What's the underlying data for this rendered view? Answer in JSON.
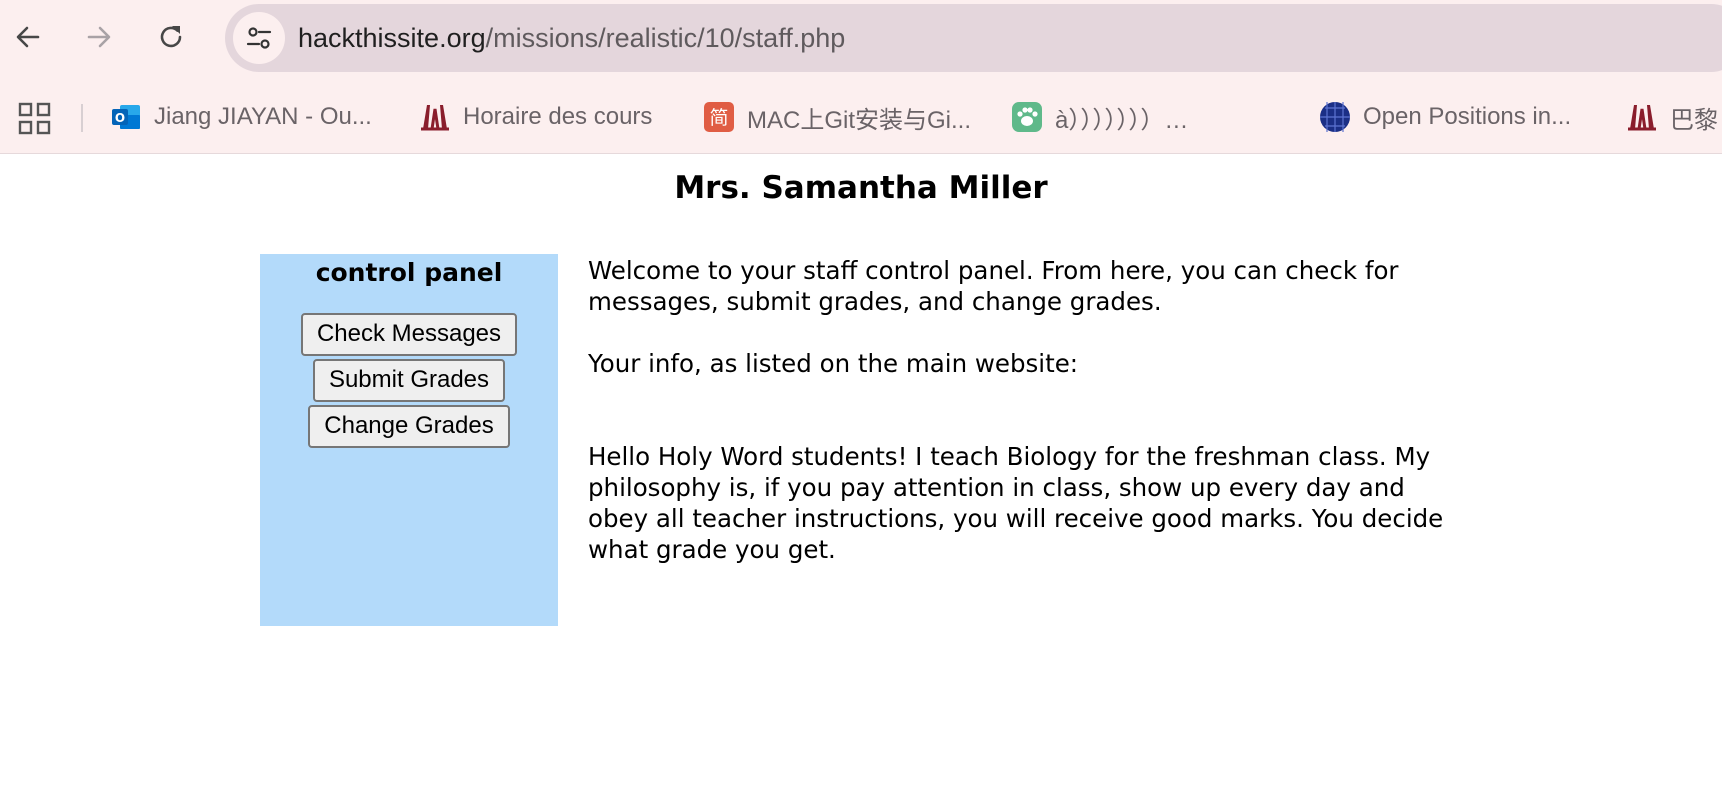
{
  "browser": {
    "url_host": "hackthissite.org",
    "url_path": "/missions/realistic/10/staff.php",
    "bookmarks": [
      {
        "label": "Jiang JIAYAN - Ou...",
        "icon": "outlook-icon"
      },
      {
        "label": "Horaire des cours",
        "icon": "university-logo-icon"
      },
      {
        "label": "MAC上Git安装与Gi...",
        "icon": "jianshu-icon"
      },
      {
        "label": "à）））））））…",
        "icon": "paw-icon"
      },
      {
        "label": "Open Positions in...",
        "icon": "globe-grid-icon"
      },
      {
        "label": "巴黎",
        "icon": "university-logo-icon"
      }
    ]
  },
  "page": {
    "title": "Mrs. Samantha Miller",
    "panel": {
      "heading": "control panel",
      "buttons": {
        "check_messages": "Check Messages",
        "submit_grades": "Submit Grades",
        "change_grades": "Change Grades"
      }
    },
    "welcome": "Welcome to your staff control panel. From here, you can check for messages, submit grades, and change grades.",
    "info_label": "Your info, as listed on the main website:",
    "bio": "Hello Holy Word students! I teach Biology for the freshman class. My philosophy is, if you pay attention in class, show up every day and obey all teacher instructions, you will receive good marks. You decide what grade you get."
  },
  "colors": {
    "chrome_bg": "#fcefef",
    "omnibox_bg": "#e4d6dc",
    "panel_bg": "#b3dafa"
  }
}
